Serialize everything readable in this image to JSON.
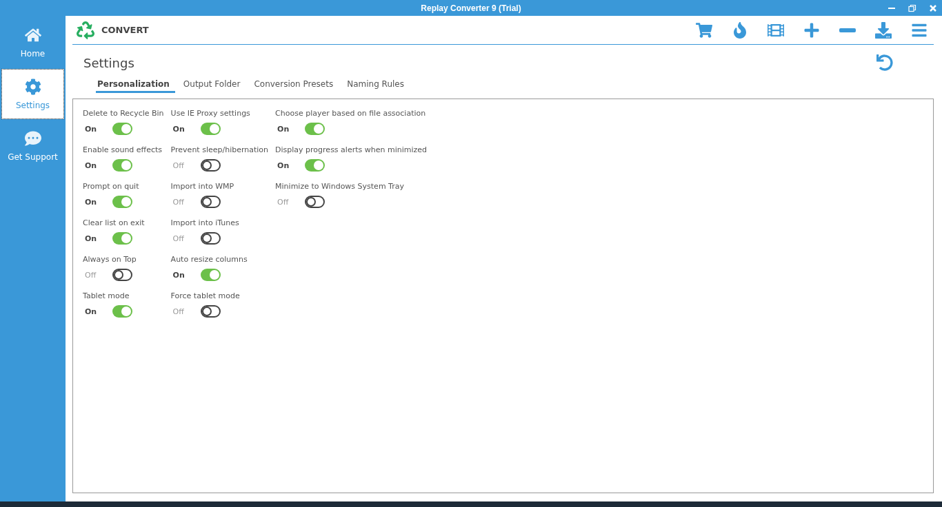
{
  "window": {
    "title": "Replay Converter 9 (Trial)"
  },
  "sidebar": {
    "items": [
      {
        "label": "Home",
        "selected": false
      },
      {
        "label": "Settings",
        "selected": true
      },
      {
        "label": "Get Support",
        "selected": false
      }
    ]
  },
  "header": {
    "title": "CONVERT"
  },
  "page_title": "Settings",
  "tabs": [
    {
      "label": "Personalization",
      "selected": true
    },
    {
      "label": "Output Folder",
      "selected": false
    },
    {
      "label": "Conversion Presets",
      "selected": false
    },
    {
      "label": "Naming Rules",
      "selected": false
    }
  ],
  "settings_columns": [
    [
      {
        "label": "Delete to Recycle Bin",
        "state": "On",
        "on": true
      },
      {
        "label": "Enable sound effects",
        "state": "On",
        "on": true
      },
      {
        "label": "Prompt on quit",
        "state": "On",
        "on": true
      },
      {
        "label": "Clear list on exit",
        "state": "On",
        "on": true
      },
      {
        "label": "Always on Top",
        "state": "Off",
        "on": false
      },
      {
        "label": "Tablet mode",
        "state": "On",
        "on": true
      }
    ],
    [
      {
        "label": "Use IE Proxy settings",
        "state": "On",
        "on": true
      },
      {
        "label": "Prevent sleep/hibernation",
        "state": "Off",
        "on": false
      },
      {
        "label": "Import into WMP",
        "state": "Off",
        "on": false
      },
      {
        "label": "Import into iTunes",
        "state": "Off",
        "on": false
      },
      {
        "label": "Auto resize columns",
        "state": "On",
        "on": true
      },
      {
        "label": "Force tablet mode",
        "state": "Off",
        "on": false
      }
    ],
    [
      {
        "label": "Choose player based on file association",
        "state": "On",
        "on": true
      },
      {
        "label": "Display progress alerts when minimized",
        "state": "On",
        "on": true
      },
      {
        "label": "Minimize to Windows System Tray",
        "state": "Off",
        "on": false
      }
    ]
  ]
}
